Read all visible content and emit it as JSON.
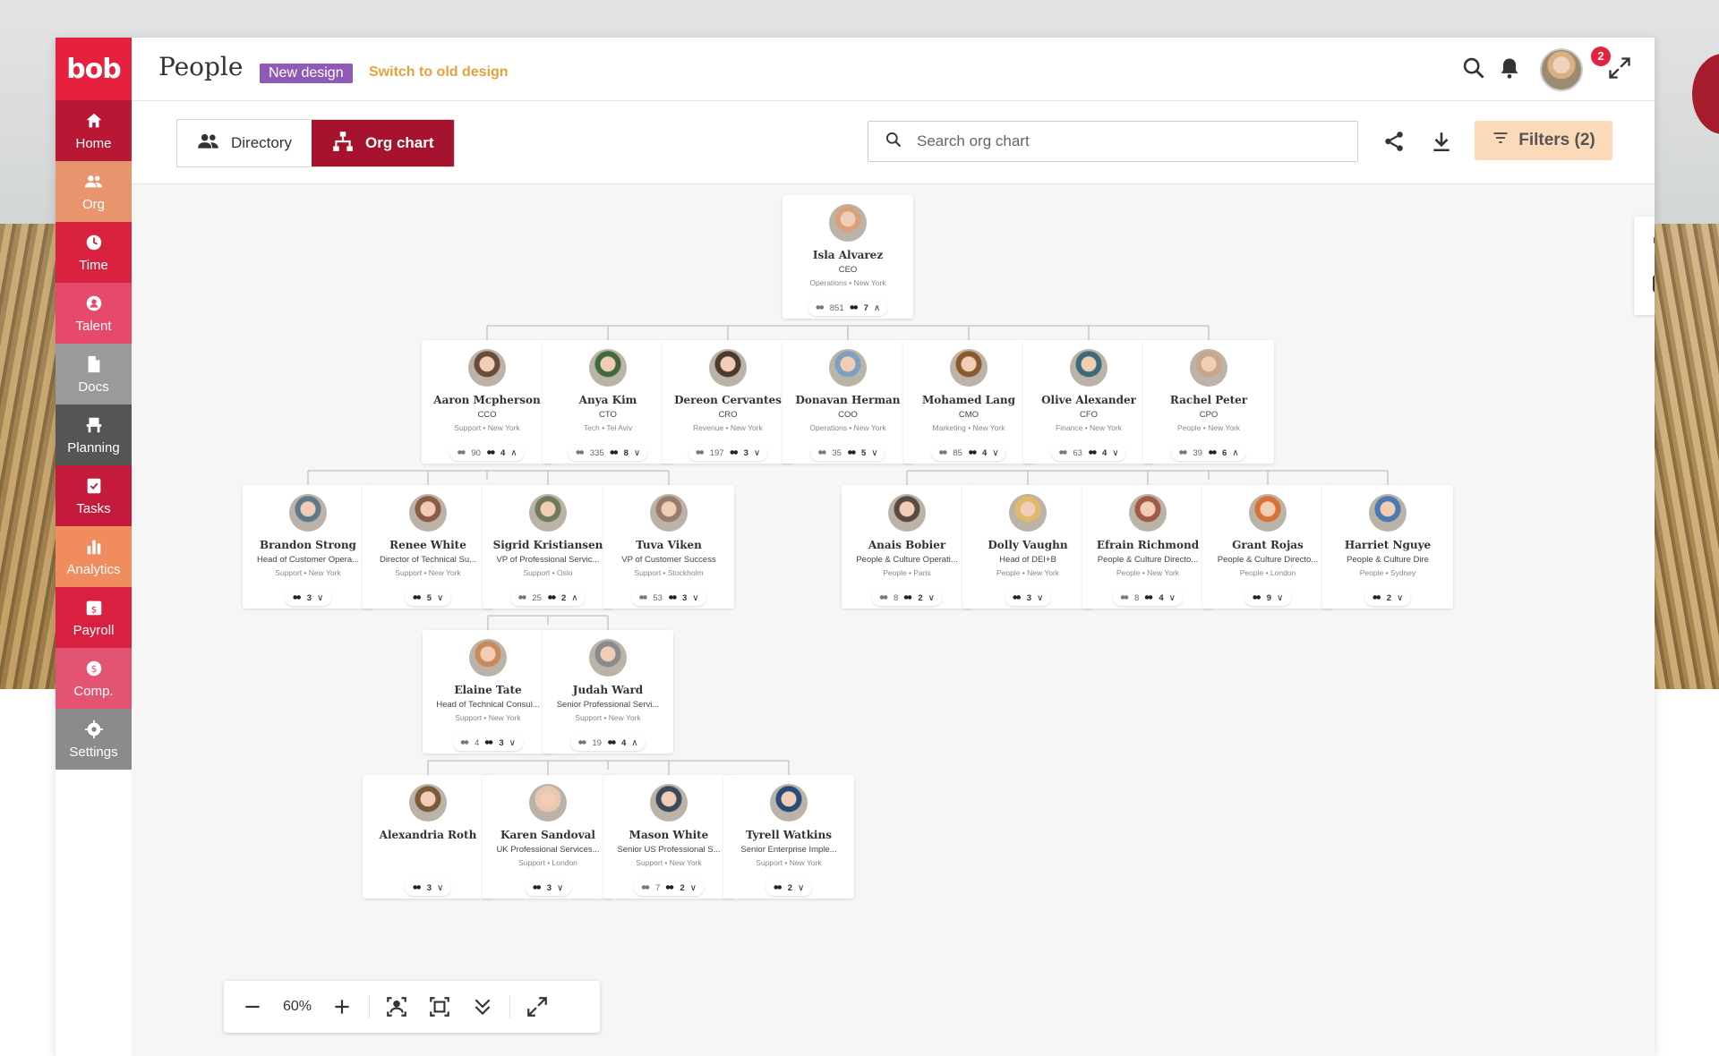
{
  "app": {
    "logo": "bob",
    "page_title": "People",
    "new_design_label": "New design",
    "switch_link": "Switch to old design",
    "notification_count": "2"
  },
  "colors": {
    "brand_red": "#e5213e",
    "accent_dark_red": "#a6132e",
    "purple": "#8e5ab5",
    "orange_link": "#e8a13a",
    "filters_bg": "#fbd9b9"
  },
  "sidebar": {
    "items": [
      {
        "label": "Home",
        "icon": "home-icon",
        "color": "#b81834"
      },
      {
        "label": "Org",
        "icon": "org-icon",
        "color": "#e8946d",
        "active": true
      },
      {
        "label": "Time",
        "icon": "clock-icon",
        "color": "#d82240"
      },
      {
        "label": "Talent",
        "icon": "talent-icon",
        "color": "#e7496b"
      },
      {
        "label": "Docs",
        "icon": "doc-icon",
        "color": "#9a9a9a"
      },
      {
        "label": "Planning",
        "icon": "planning-icon",
        "color": "#555555"
      },
      {
        "label": "Tasks",
        "icon": "tasks-icon",
        "color": "#c41a3b"
      },
      {
        "label": "Analytics",
        "icon": "analytics-icon",
        "color": "#f08c5e"
      },
      {
        "label": "Payroll",
        "icon": "payroll-icon",
        "color": "#d92040"
      },
      {
        "label": "Comp.",
        "icon": "comp-icon",
        "color": "#e35472"
      },
      {
        "label": "Settings",
        "icon": "gear-icon",
        "color": "#8b8b8b"
      }
    ]
  },
  "toolbar": {
    "directory_label": "Directory",
    "orgchart_label": "Org chart",
    "search_placeholder": "Search org chart",
    "filters_label": "Filters (2)"
  },
  "zoom": {
    "level": "60%"
  },
  "people": [
    {
      "name": "Isla Alvarez",
      "role": "CEO",
      "loc": "Operations • New York",
      "total": "851",
      "reports": "7",
      "expanded": true,
      "av": "#d9a07a"
    },
    {
      "name": "Aaron Mcpherson",
      "role": "CCO",
      "loc": "Support • New York",
      "total": "90",
      "reports": "4",
      "expanded": true,
      "av": "#6a4b3a"
    },
    {
      "name": "Anya Kim",
      "role": "CTO",
      "loc": "Tech • Tel Aviv",
      "total": "335",
      "reports": "8",
      "expanded": false,
      "av": "#3f6b3c"
    },
    {
      "name": "Dereon Cervantes",
      "role": "CRO",
      "loc": "Revenue • New York",
      "total": "197",
      "reports": "3",
      "expanded": false,
      "av": "#4a3a30"
    },
    {
      "name": "Donavan Herman",
      "role": "COO",
      "loc": "Operations • New York",
      "total": "35",
      "reports": "5",
      "expanded": false,
      "av": "#7aa0c4"
    },
    {
      "name": "Mohamed Lang",
      "role": "CMO",
      "loc": "Marketing • New York",
      "total": "85",
      "reports": "4",
      "expanded": false,
      "av": "#8a5a2e"
    },
    {
      "name": "Olive Alexander",
      "role": "CFO",
      "loc": "Finance • New York",
      "total": "63",
      "reports": "4",
      "expanded": false,
      "av": "#3b6b7a"
    },
    {
      "name": "Rachel Peter",
      "role": "CPO",
      "loc": "People • New York",
      "total": "39",
      "reports": "6",
      "expanded": true,
      "av": "#c9a58a"
    },
    {
      "name": "Brandon Strong",
      "role": "Head of Customer Opera...",
      "loc": "Support • New York",
      "total": "",
      "reports": "3",
      "expanded": false,
      "av": "#5d7a8a"
    },
    {
      "name": "Renee White",
      "role": "Director of Technical Su...",
      "loc": "Support • New York",
      "total": "",
      "reports": "5",
      "expanded": false,
      "av": "#8a5c45"
    },
    {
      "name": "Sigrid Kristiansen",
      "role": "VP of Professional Servic...",
      "loc": "Support • Oslo",
      "total": "25",
      "reports": "2",
      "expanded": true,
      "av": "#6f7a5a"
    },
    {
      "name": "Tuva Viken",
      "role": "VP of Customer Success",
      "loc": "Support • Stockholm",
      "total": "53",
      "reports": "3",
      "expanded": false,
      "av": "#9a7a6a"
    },
    {
      "name": "Anais Bobier",
      "role": "People & Culture Operati...",
      "loc": "People • Paris",
      "total": "8",
      "reports": "2",
      "expanded": false,
      "av": "#5a4a44"
    },
    {
      "name": "Dolly Vaughn",
      "role": "Head of DEI+B",
      "loc": "People • New York",
      "total": "",
      "reports": "3",
      "expanded": false,
      "av": "#e0b96a"
    },
    {
      "name": "Efrain Richmond",
      "role": "People & Culture Directo...",
      "loc": "People • New York",
      "total": "8",
      "reports": "4",
      "expanded": false,
      "av": "#a05a48"
    },
    {
      "name": "Grant Rojas",
      "role": "People & Culture Directo...",
      "loc": "People • London",
      "total": "",
      "reports": "9",
      "expanded": false,
      "av": "#d8703a"
    },
    {
      "name": "Harriet Nguye",
      "role": "People & Culture Dire",
      "loc": "People • Sydney",
      "total": "",
      "reports": "2",
      "expanded": false,
      "av": "#4a7ab0"
    },
    {
      "name": "Elaine Tate",
      "role": "Head of Technical Consul...",
      "loc": "Support • New York",
      "total": "4",
      "reports": "3",
      "expanded": false,
      "av": "#c98a5a"
    },
    {
      "name": "Judah Ward",
      "role": "Senior Professional Servi...",
      "loc": "Support • New York",
      "total": "19",
      "reports": "4",
      "expanded": true,
      "av": "#8a8a8a"
    },
    {
      "name": "Alexandria Roth",
      "role": "",
      "loc": "",
      "total": "",
      "reports": "3",
      "expanded": false,
      "av": "#7a5a3a"
    },
    {
      "name": "Karen Sandoval",
      "role": "UK Professional Services...",
      "loc": "Support • London",
      "total": "",
      "reports": "3",
      "expanded": false,
      "av": "#e8c8b0"
    },
    {
      "name": "Mason White",
      "role": "Senior US Professional S...",
      "loc": "Support • New York",
      "total": "7",
      "reports": "2",
      "expanded": false,
      "av": "#3a4a5a"
    },
    {
      "name": "Tyrell Watkins",
      "role": "Senior Enterprise Imple...",
      "loc": "Support • New York",
      "total": "",
      "reports": "2",
      "expanded": false,
      "av": "#2a4a7a"
    }
  ]
}
